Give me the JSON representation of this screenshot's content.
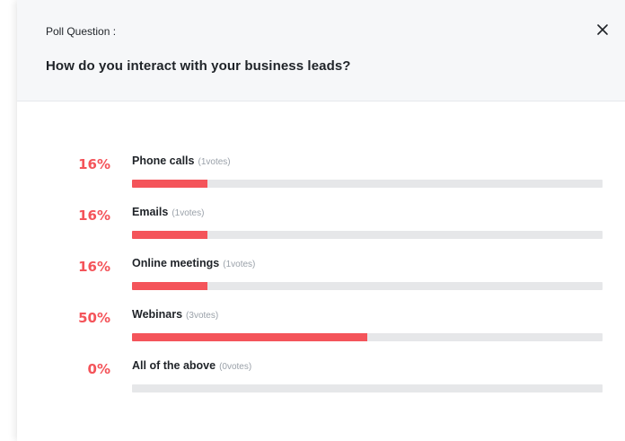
{
  "header": {
    "label": "Poll Question :",
    "question": "How do you interact with your business leads?",
    "close_icon": "close-icon"
  },
  "options": [
    {
      "percent": "16%",
      "label": "Phone calls",
      "votes": "(1votes)",
      "fill_fraction": 0.16
    },
    {
      "percent": "16%",
      "label": "Emails",
      "votes": "(1votes)",
      "fill_fraction": 0.16
    },
    {
      "percent": "16%",
      "label": "Online meetings",
      "votes": "(1votes)",
      "fill_fraction": 0.16
    },
    {
      "percent": "50%",
      "label": "Webinars",
      "votes": "(3votes)",
      "fill_fraction": 0.5
    },
    {
      "percent": "0%",
      "label": "All of the above",
      "votes": "(0votes)",
      "fill_fraction": 0.0
    }
  ],
  "colors": {
    "accent": "#f4545a",
    "track": "#e6e7e9",
    "header_bg": "#f6f7f9"
  }
}
